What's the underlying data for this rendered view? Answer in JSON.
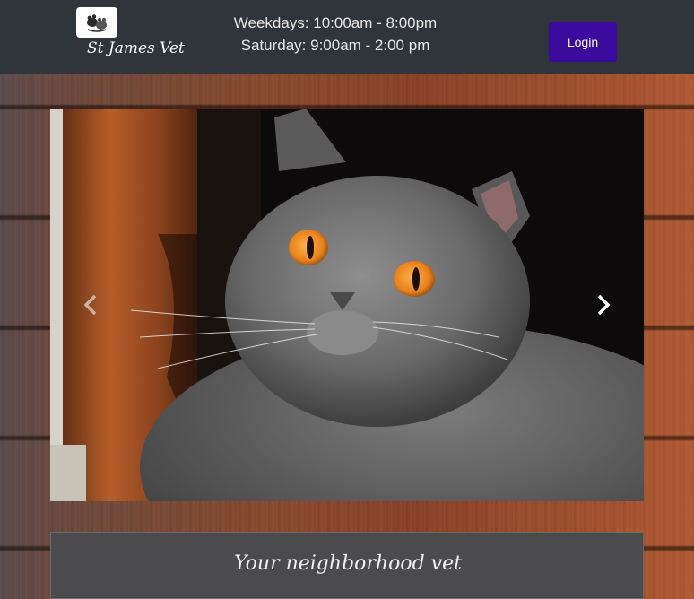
{
  "header": {
    "brand_name": "St James Vet",
    "logo_icon": "paw-pets-logo-icon",
    "hours": {
      "weekdays": "Weekdays: 10:00am - 8:00pm",
      "saturday": "Saturday: 9:00am - 2:00 pm"
    },
    "login_label": "Login",
    "colors": {
      "header_bg": "#30353c",
      "login_bg": "#3c0b9e"
    }
  },
  "carousel": {
    "current_slide_subject": "grey british shorthair cat with orange eyes",
    "prev_icon": "chevron-left-icon",
    "next_icon": "chevron-right-icon"
  },
  "tagline": {
    "text": "Your neighborhood vet"
  }
}
